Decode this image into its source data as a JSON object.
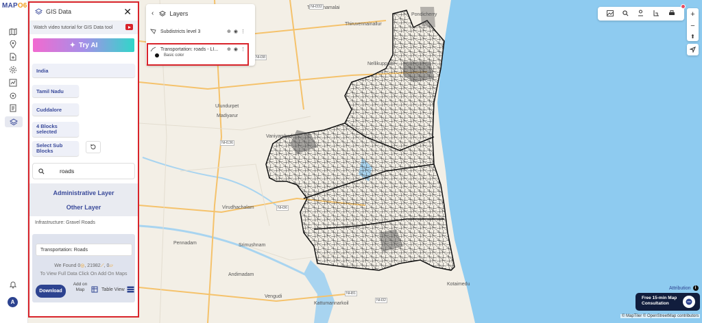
{
  "app": {
    "logo_main": "MAP",
    "logo_accent": "O6"
  },
  "rail": {
    "avatar_initial": "A"
  },
  "panel": {
    "title": "GIS Data",
    "tutorial_text": "Watch video tutorial for GIS Data tool",
    "try_ai_label": "Try AI",
    "country": "India",
    "state": "Tamil Nadu",
    "district": "Cuddalore",
    "blocks": "4 Blocks selected",
    "sub_blocks": "Select Sub Blocks",
    "search_value": "roads",
    "administrative_layer": "Administrative Layer",
    "other_layer": "Other Layer",
    "infrastructure_item": "Infrastructure: Gravel Roads",
    "result": {
      "label": "Transportation: Roads",
      "found_prefix": "We Found",
      "count_a": "0",
      "count_b": "21982",
      "count_c": "0",
      "view_hint": "To View Full Data Click On Add On Maps",
      "download_label": "Download",
      "add_on_map_label": "Add on Map",
      "table_view_label": "Table View"
    }
  },
  "layers": {
    "title": "Layers",
    "items": [
      {
        "label": "Subdistricts level 3"
      },
      {
        "label": "Transportation: roads - LI..."
      }
    ],
    "base_color_label": "Basic color",
    "base_color": "#111111"
  },
  "map": {
    "places": [
      "Tiruvannamalai",
      "Thiruvennainallur",
      "Ulundurpet",
      "Madiyarur",
      "Virudhachalam",
      "Pennadam",
      "Srimushnam",
      "Andimadam",
      "Vaniyambadi",
      "Nellikuppam",
      "Vengudi",
      "Kattumannarkoil",
      "Kotaimedu",
      "Pondicherry"
    ],
    "highways": [
      "NH332",
      "NH38",
      "NH136",
      "NH36",
      "NH81",
      "NH32"
    ],
    "attribution_label": "Attribution",
    "consult_line1": "Free 15-min Map",
    "consult_line2": "Consultation",
    "credits": "© MapTiler © OpenStreetMap contributors"
  }
}
